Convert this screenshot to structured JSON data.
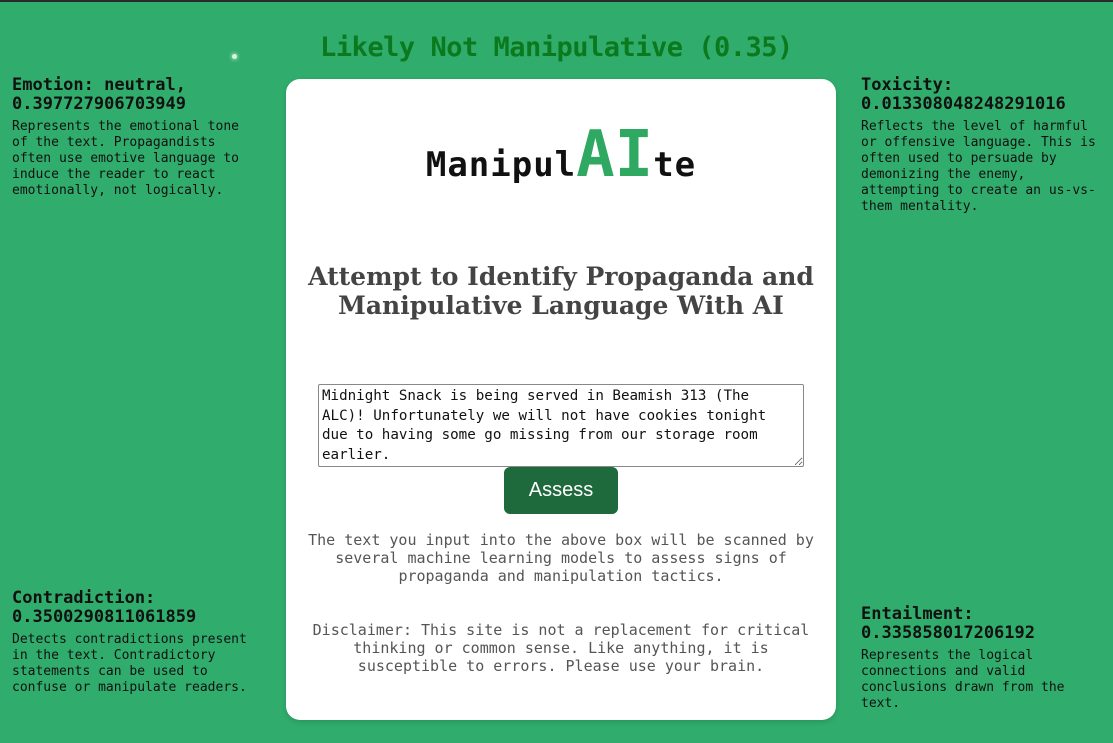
{
  "verdict": "Likely Not Manipulative (0.35)",
  "metrics": {
    "emotion": {
      "name": "Emotion: neutral,",
      "value": "0.397727906703949",
      "description": "Represents the emotional tone of the text. Propagandists often use emotive language to induce the reader to react emotionally, not logically."
    },
    "toxicity": {
      "name": "Toxicity:",
      "value": "0.013308048248291016",
      "description": "Reflects the level of harmful or offensive language. This is often used to persuade by demonizing the enemy, attempting to create an us-vs-them mentality."
    },
    "contradiction": {
      "name": "Contradiction:",
      "value": "0.3500290811061859",
      "description": "Detects contradictions present in the text. Contradictory statements can be used to confuse or manipulate readers."
    },
    "entailment": {
      "name": "Entailment:",
      "value": "0.335858017206192",
      "description": "Represents the logical connections and valid conclusions drawn from the text."
    }
  },
  "logo": {
    "part1": "Manipul",
    "part2": "AI",
    "part3": "te"
  },
  "headline": "Attempt to Identify Propaganda and Manipulative Language With AI",
  "input": {
    "value": "Midnight Snack is being served in Beamish 313 (The ALC)! Unfortunately we will not have cookies tonight due to having some go missing from our storage room earlier."
  },
  "assess_label": "Assess",
  "info_text": "The text you input into the above box will be scanned by several machine learning models to assess signs of propaganda and manipulation tactics.",
  "disclaimer": "Disclaimer: This site is not a replacement for critical thinking or common sense. Like anything, it is susceptible to errors. Please use your brain.",
  "colors": {
    "background": "#30ad6c",
    "verdict": "#0b7a1f",
    "logo_accent": "#2fa862",
    "button": "#1f6a3d"
  }
}
